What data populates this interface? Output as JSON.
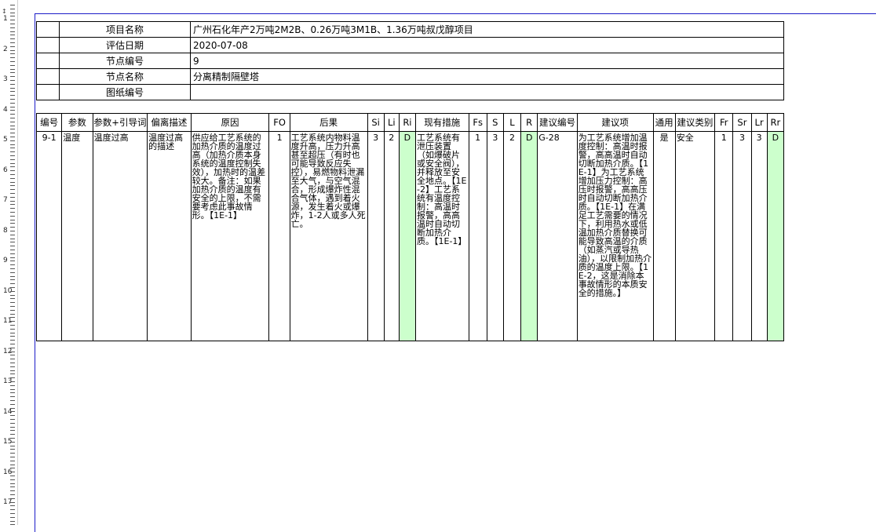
{
  "info": {
    "rows": [
      {
        "label": "项目名称",
        "value": "广州石化年产2万吨2M2B、0.26万吨3M1B、1.36万吨叔戊醇项目"
      },
      {
        "label": "评估日期",
        "value": "2020-07-08"
      },
      {
        "label": "节点编号",
        "value": "9"
      },
      {
        "label": "节点名称",
        "value": "分离精制隔壁塔"
      },
      {
        "label": "图纸编号",
        "value": ""
      }
    ]
  },
  "table": {
    "headers": [
      "编号",
      "参数",
      "参数+引导词",
      "偏离描述",
      "原因",
      "FO",
      "后果",
      "Si",
      "Li",
      "Ri",
      "现有措施",
      "Fs",
      "S",
      "L",
      "R",
      "建议编号",
      "建议项",
      "通用",
      "建议类别",
      "Fr",
      "Sr",
      "Lr",
      "Rr"
    ],
    "row": {
      "id": "9-1",
      "param": "温度",
      "guide": "温度过高",
      "deviation": "温度过高的描述",
      "cause": "供应给工艺系统的加热介质的温度过高（加热介质本身系统的温度控制失效），加热时的温差较大。备注：如果加热介质的温度有安全的上限，不需要考虑此事故情形。【1E-1】",
      "fo": "1",
      "consequence": "工艺系统内物料温度升高，压力升高甚至超压（有时也可能导致反应失控），易燃物料泄漏至大气，与空气混合，形成爆炸性混合气体，遇到着火源，发生着火或爆炸，1-2人或多人死亡。",
      "si": "3",
      "li": "2",
      "ri": "D",
      "measures": "工艺系统有泄压装置（如爆破片或安全阀），并释放至安全地点。【1E-2】工艺系统有温度控制：高温时报警，高高温时自动切断加热介质。【1E-1】",
      "fs": "1",
      "s": "3",
      "l": "2",
      "r": "D",
      "rec_id": "G-28",
      "recommendation": "为工艺系统增加温度控制：高温时报警，高高温时自动切断加热介质。【1E-1】为工艺系统增加压力控制：高压时报警，高高压时自动切断加热介质。【1E-1】在满足工艺需要的情况下，利用热水或低温加热介质替换可能导致高温的介质（如蒸汽或导热油），以限制加热介质的温度上限。【1E-2，这是消除本事故情形的本质安全的措施。】",
      "general": "是",
      "category": "安全",
      "fr": "1",
      "sr": "3",
      "lr": "3",
      "rr": "D"
    }
  },
  "ruler": {
    "labels": [
      "1",
      "2",
      "3",
      "4",
      "5",
      "6",
      "7",
      "8",
      "9",
      "10",
      "11",
      "12",
      "13",
      "14",
      "15",
      "16",
      "17"
    ]
  },
  "colors": {
    "risk_cell": "#ccffcc",
    "frame": "#1c1cc8"
  }
}
